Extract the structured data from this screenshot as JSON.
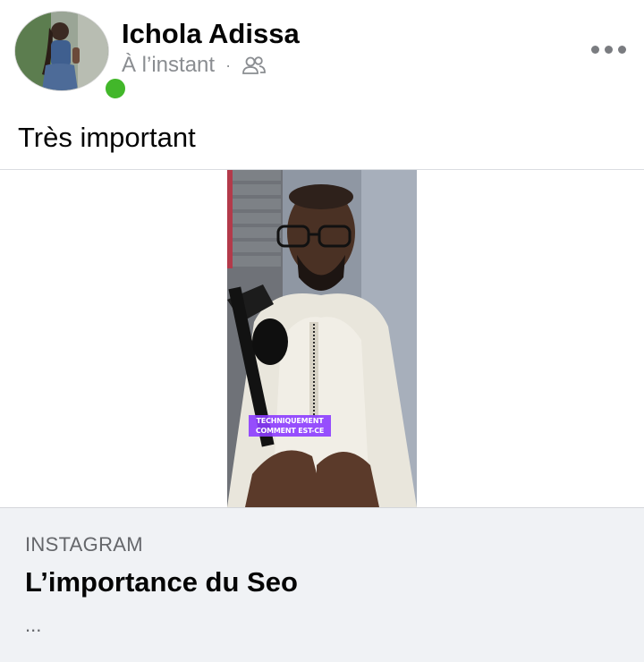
{
  "post": {
    "author_name": "Ichola Adissa",
    "timestamp": "À l’instant",
    "separator": "·",
    "audience_icon": "friends-icon",
    "more_icon": "more-options-icon",
    "online_status_color": "#42b72a",
    "text": "Très important"
  },
  "video": {
    "caption_line1": "TECHNIQUEMENT",
    "caption_line2": "COMMENT EST-CE"
  },
  "link_card": {
    "source": "INSTAGRAM",
    "title": "L’importance du Seo",
    "description": "..."
  }
}
